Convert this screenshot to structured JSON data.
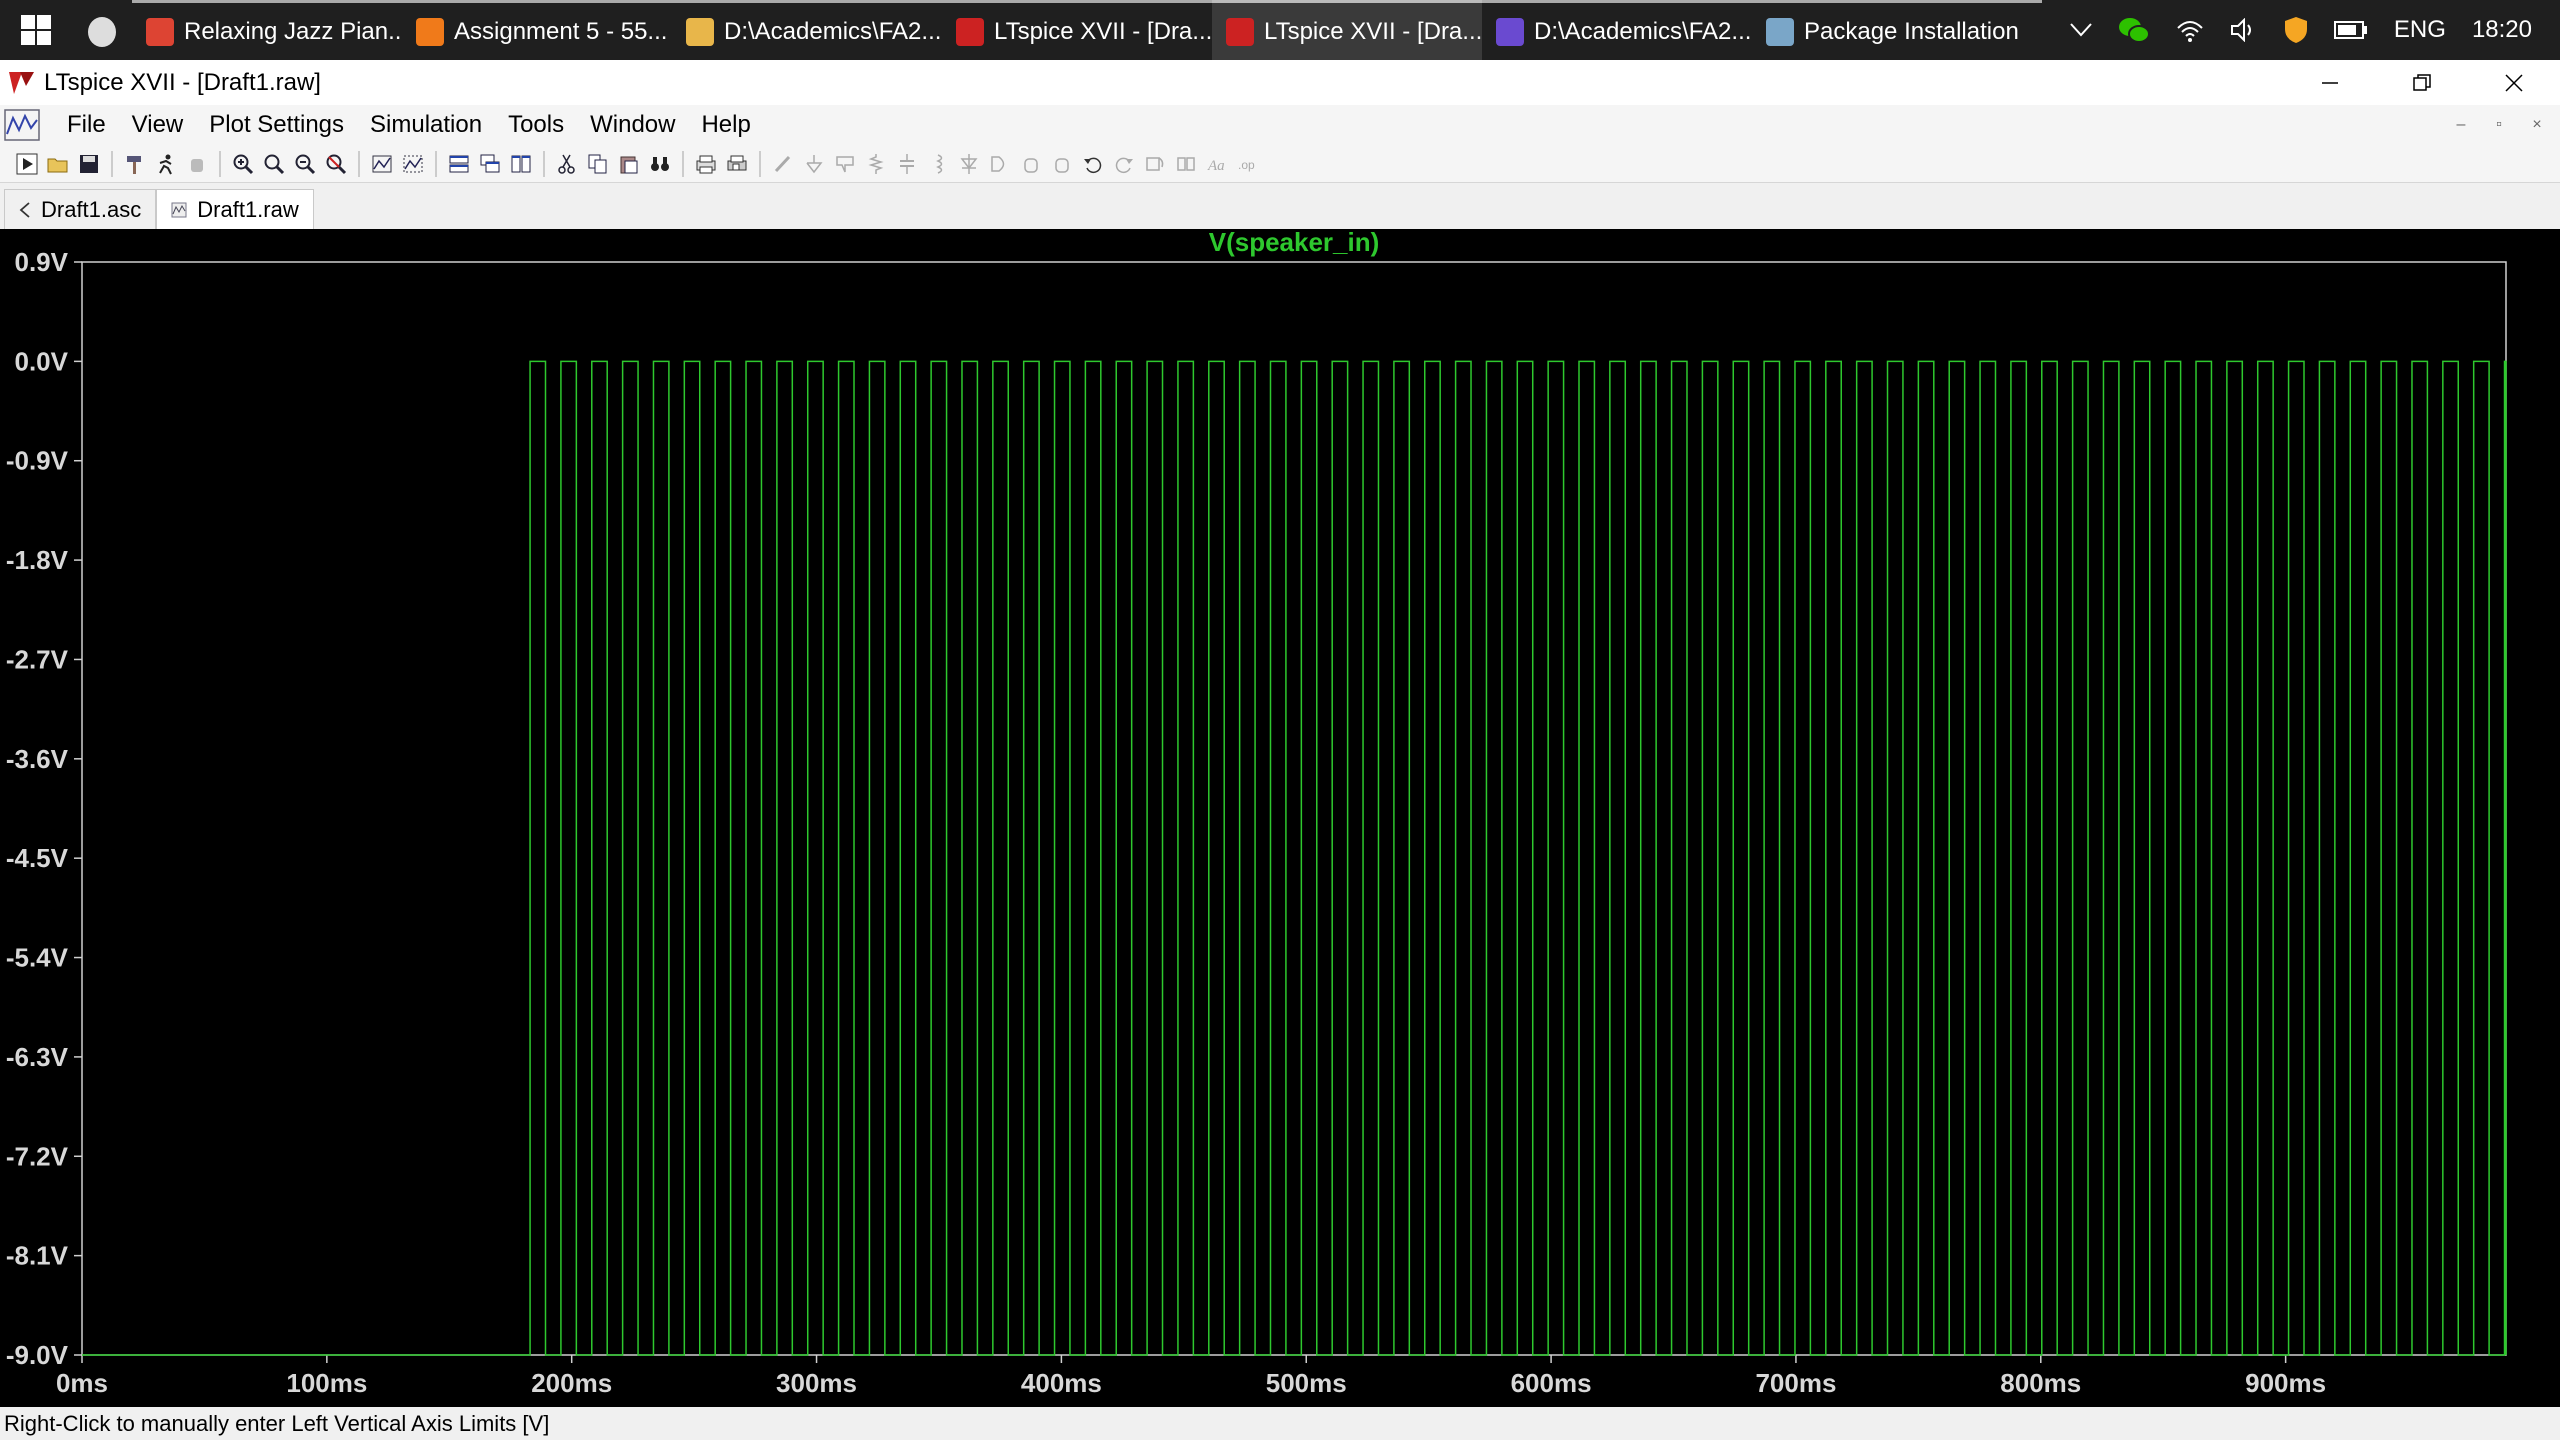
{
  "taskbar": {
    "items": [
      {
        "label": "Relaxing Jazz Pian...",
        "icon": "chrome-icon",
        "color": "#dd4433"
      },
      {
        "label": "Assignment 5 - 55...",
        "icon": "document-app-icon",
        "color": "#f07a1a"
      },
      {
        "label": "D:\\Academics\\FA2...",
        "icon": "folder-icon",
        "color": "#e8b64a"
      },
      {
        "label": "LTspice XVII - [Dra...",
        "icon": "ltspice-icon",
        "color": "#cc2222"
      },
      {
        "label": "LTspice XVII - [Dra...",
        "icon": "ltspice-icon",
        "color": "#cc2222"
      },
      {
        "label": "D:\\Academics\\FA2...",
        "icon": "visual-studio-icon",
        "color": "#6a4ad0"
      },
      {
        "label": "Package Installation",
        "icon": "installer-icon",
        "color": "#7aa6c8"
      }
    ],
    "tray": {
      "language": "ENG",
      "time": "18:20"
    }
  },
  "window": {
    "title": "LTspice XVII - [Draft1.raw]"
  },
  "menu": {
    "items": [
      "File",
      "View",
      "Plot Settings",
      "Simulation",
      "Tools",
      "Window",
      "Help"
    ]
  },
  "tabs": [
    {
      "label": "Draft1.asc",
      "active": false
    },
    {
      "label": "Draft1.raw",
      "active": true
    }
  ],
  "status": {
    "text": "Right-Click to manually enter Left Vertical Axis Limits [V]"
  },
  "chart_data": {
    "type": "line",
    "title": "V(speaker_in)",
    "xlabel": "",
    "ylabel": "",
    "x_ticks": [
      "0ms",
      "100ms",
      "200ms",
      "300ms",
      "400ms",
      "500ms",
      "600ms",
      "700ms",
      "800ms",
      "900ms"
    ],
    "y_ticks": [
      "0.9V",
      "0.0V",
      "-0.9V",
      "-1.8V",
      "-2.7V",
      "-3.6V",
      "-4.5V",
      "-5.4V",
      "-6.3V",
      "-7.2V",
      "-8.1V",
      "-9.0V"
    ],
    "xlim_ms": [
      0,
      990
    ],
    "ylim_v": [
      -9.0,
      0.9
    ],
    "series": [
      {
        "name": "V(speaker_in)",
        "color": "#2ec82e",
        "kind": "square_wave",
        "start_ms": 183,
        "end_ms": 990,
        "period_ms": 12.6,
        "duty": 0.5,
        "high_v": 0.0,
        "low_v": -9.0,
        "baseline_v": -9.0
      }
    ],
    "grid": false,
    "background": "#000000",
    "axis_color": "#d0d0d0",
    "title_color": "#2ec82e"
  }
}
